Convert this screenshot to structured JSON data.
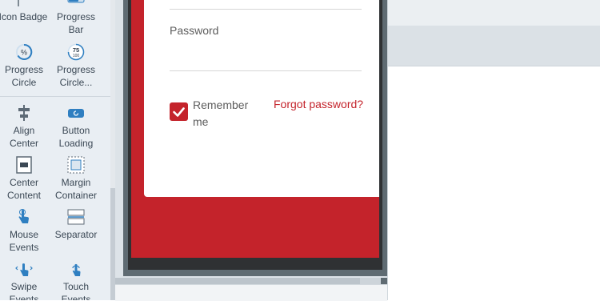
{
  "palette": {
    "items": [
      {
        "label": "Icon Badge",
        "icon": "flag-icon"
      },
      {
        "label": "Progress Bar",
        "icon": "progress-bar-icon"
      },
      {
        "label": "Progress Circle",
        "icon": "percent-circle-icon"
      },
      {
        "label": "Progress Circle...",
        "icon": "progress-circle-75-icon",
        "icon_text_top": "75",
        "icon_text_bottom": "100"
      },
      {
        "label": "Align Center",
        "icon": "align-center-icon"
      },
      {
        "label": "Button Loading",
        "icon": "button-loading-icon"
      },
      {
        "label": "Center Content",
        "icon": "center-content-icon"
      },
      {
        "label": "Margin Container",
        "icon": "margin-container-icon"
      },
      {
        "label": "Mouse Events",
        "icon": "pointer-hand-icon"
      },
      {
        "label": "Separator",
        "icon": "separator-icon"
      },
      {
        "label": "Swipe Events",
        "icon": "swipe-icon"
      },
      {
        "label": "Touch Events",
        "icon": "touch-icon"
      }
    ]
  },
  "form": {
    "password_label": "Password",
    "remember_label": "Remember me",
    "remember_checked": true,
    "forgot_link": "Forgot password?"
  },
  "colors": {
    "accent": "#c4232b",
    "palette_icon": "#2f7fc1"
  }
}
